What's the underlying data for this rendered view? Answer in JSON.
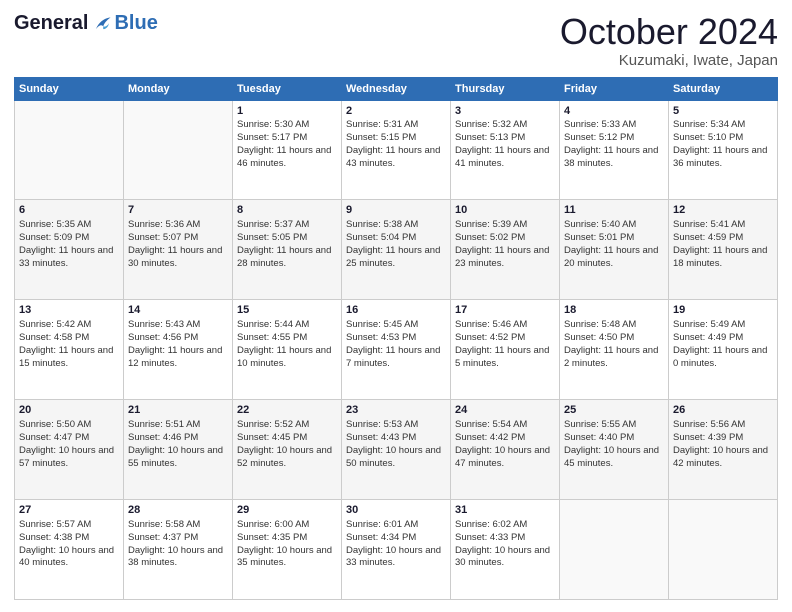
{
  "logo": {
    "general": "General",
    "blue": "Blue"
  },
  "header": {
    "month": "October 2024",
    "location": "Kuzumaki, Iwate, Japan"
  },
  "weekdays": [
    "Sunday",
    "Monday",
    "Tuesday",
    "Wednesday",
    "Thursday",
    "Friday",
    "Saturday"
  ],
  "weeks": [
    [
      {
        "day": "",
        "info": ""
      },
      {
        "day": "",
        "info": ""
      },
      {
        "day": "1",
        "info": "Sunrise: 5:30 AM\nSunset: 5:17 PM\nDaylight: 11 hours and 46 minutes."
      },
      {
        "day": "2",
        "info": "Sunrise: 5:31 AM\nSunset: 5:15 PM\nDaylight: 11 hours and 43 minutes."
      },
      {
        "day": "3",
        "info": "Sunrise: 5:32 AM\nSunset: 5:13 PM\nDaylight: 11 hours and 41 minutes."
      },
      {
        "day": "4",
        "info": "Sunrise: 5:33 AM\nSunset: 5:12 PM\nDaylight: 11 hours and 38 minutes."
      },
      {
        "day": "5",
        "info": "Sunrise: 5:34 AM\nSunset: 5:10 PM\nDaylight: 11 hours and 36 minutes."
      }
    ],
    [
      {
        "day": "6",
        "info": "Sunrise: 5:35 AM\nSunset: 5:09 PM\nDaylight: 11 hours and 33 minutes."
      },
      {
        "day": "7",
        "info": "Sunrise: 5:36 AM\nSunset: 5:07 PM\nDaylight: 11 hours and 30 minutes."
      },
      {
        "day": "8",
        "info": "Sunrise: 5:37 AM\nSunset: 5:05 PM\nDaylight: 11 hours and 28 minutes."
      },
      {
        "day": "9",
        "info": "Sunrise: 5:38 AM\nSunset: 5:04 PM\nDaylight: 11 hours and 25 minutes."
      },
      {
        "day": "10",
        "info": "Sunrise: 5:39 AM\nSunset: 5:02 PM\nDaylight: 11 hours and 23 minutes."
      },
      {
        "day": "11",
        "info": "Sunrise: 5:40 AM\nSunset: 5:01 PM\nDaylight: 11 hours and 20 minutes."
      },
      {
        "day": "12",
        "info": "Sunrise: 5:41 AM\nSunset: 4:59 PM\nDaylight: 11 hours and 18 minutes."
      }
    ],
    [
      {
        "day": "13",
        "info": "Sunrise: 5:42 AM\nSunset: 4:58 PM\nDaylight: 11 hours and 15 minutes."
      },
      {
        "day": "14",
        "info": "Sunrise: 5:43 AM\nSunset: 4:56 PM\nDaylight: 11 hours and 12 minutes."
      },
      {
        "day": "15",
        "info": "Sunrise: 5:44 AM\nSunset: 4:55 PM\nDaylight: 11 hours and 10 minutes."
      },
      {
        "day": "16",
        "info": "Sunrise: 5:45 AM\nSunset: 4:53 PM\nDaylight: 11 hours and 7 minutes."
      },
      {
        "day": "17",
        "info": "Sunrise: 5:46 AM\nSunset: 4:52 PM\nDaylight: 11 hours and 5 minutes."
      },
      {
        "day": "18",
        "info": "Sunrise: 5:48 AM\nSunset: 4:50 PM\nDaylight: 11 hours and 2 minutes."
      },
      {
        "day": "19",
        "info": "Sunrise: 5:49 AM\nSunset: 4:49 PM\nDaylight: 11 hours and 0 minutes."
      }
    ],
    [
      {
        "day": "20",
        "info": "Sunrise: 5:50 AM\nSunset: 4:47 PM\nDaylight: 10 hours and 57 minutes."
      },
      {
        "day": "21",
        "info": "Sunrise: 5:51 AM\nSunset: 4:46 PM\nDaylight: 10 hours and 55 minutes."
      },
      {
        "day": "22",
        "info": "Sunrise: 5:52 AM\nSunset: 4:45 PM\nDaylight: 10 hours and 52 minutes."
      },
      {
        "day": "23",
        "info": "Sunrise: 5:53 AM\nSunset: 4:43 PM\nDaylight: 10 hours and 50 minutes."
      },
      {
        "day": "24",
        "info": "Sunrise: 5:54 AM\nSunset: 4:42 PM\nDaylight: 10 hours and 47 minutes."
      },
      {
        "day": "25",
        "info": "Sunrise: 5:55 AM\nSunset: 4:40 PM\nDaylight: 10 hours and 45 minutes."
      },
      {
        "day": "26",
        "info": "Sunrise: 5:56 AM\nSunset: 4:39 PM\nDaylight: 10 hours and 42 minutes."
      }
    ],
    [
      {
        "day": "27",
        "info": "Sunrise: 5:57 AM\nSunset: 4:38 PM\nDaylight: 10 hours and 40 minutes."
      },
      {
        "day": "28",
        "info": "Sunrise: 5:58 AM\nSunset: 4:37 PM\nDaylight: 10 hours and 38 minutes."
      },
      {
        "day": "29",
        "info": "Sunrise: 6:00 AM\nSunset: 4:35 PM\nDaylight: 10 hours and 35 minutes."
      },
      {
        "day": "30",
        "info": "Sunrise: 6:01 AM\nSunset: 4:34 PM\nDaylight: 10 hours and 33 minutes."
      },
      {
        "day": "31",
        "info": "Sunrise: 6:02 AM\nSunset: 4:33 PM\nDaylight: 10 hours and 30 minutes."
      },
      {
        "day": "",
        "info": ""
      },
      {
        "day": "",
        "info": ""
      }
    ]
  ]
}
